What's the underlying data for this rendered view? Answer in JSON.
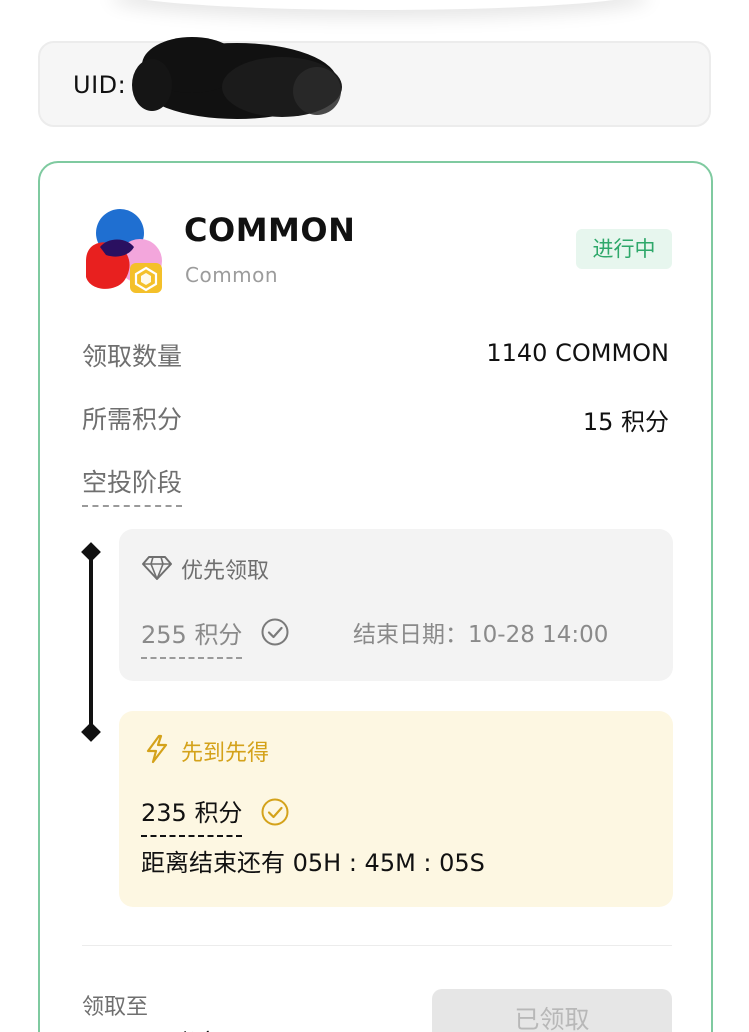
{
  "uid": {
    "label": "UID: 7"
  },
  "token": {
    "name": "COMMON",
    "subtitle": "Common",
    "status": "进行中"
  },
  "details": [
    {
      "label": "领取数量",
      "value": "1140 COMMON"
    },
    {
      "label": "所需积分",
      "value": "15 积分"
    }
  ],
  "airdrop_stage_label": "空投阶段",
  "stages": [
    {
      "title": "优先领取",
      "points": "255 积分",
      "end_label": "结束日期：",
      "end_value": "10-28 14:00",
      "icon": "diamond-icon",
      "status_icon": "check-circle-icon"
    },
    {
      "title": "先到先得",
      "points": "235 积分",
      "countdown": "距离结束还有 05H : 45M : 05S",
      "icon": "lightning-icon",
      "status_icon": "check-circle-icon"
    }
  ],
  "claim": {
    "to_label": "领取至",
    "to_value": "账户",
    "button_label": "已领取"
  },
  "colors": {
    "accent_green": "#2ea86a",
    "card_border": "#7fcaa0",
    "gold": "#d4a21a",
    "status_bg": "#e7f6ee"
  }
}
